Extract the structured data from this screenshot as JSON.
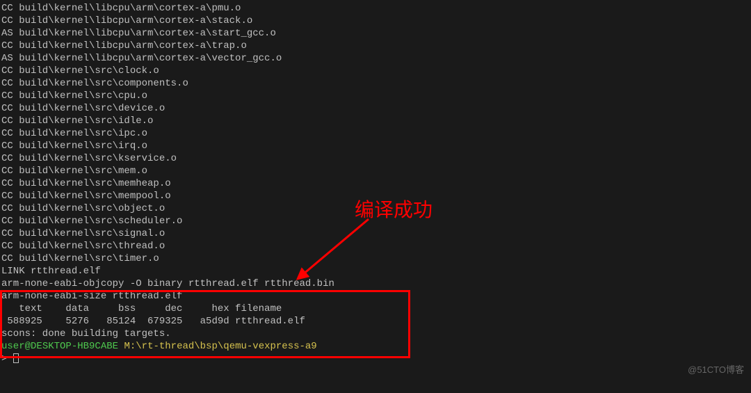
{
  "terminal": {
    "lines": [
      "CC build\\kernel\\libcpu\\arm\\cortex-a\\pmu.o",
      "CC build\\kernel\\libcpu\\arm\\cortex-a\\stack.o",
      "AS build\\kernel\\libcpu\\arm\\cortex-a\\start_gcc.o",
      "CC build\\kernel\\libcpu\\arm\\cortex-a\\trap.o",
      "AS build\\kernel\\libcpu\\arm\\cortex-a\\vector_gcc.o",
      "CC build\\kernel\\src\\clock.o",
      "CC build\\kernel\\src\\components.o",
      "CC build\\kernel\\src\\cpu.o",
      "CC build\\kernel\\src\\device.o",
      "CC build\\kernel\\src\\idle.o",
      "CC build\\kernel\\src\\ipc.o",
      "CC build\\kernel\\src\\irq.o",
      "CC build\\kernel\\src\\kservice.o",
      "CC build\\kernel\\src\\mem.o",
      "CC build\\kernel\\src\\memheap.o",
      "CC build\\kernel\\src\\mempool.o",
      "CC build\\kernel\\src\\object.o",
      "CC build\\kernel\\src\\scheduler.o",
      "CC build\\kernel\\src\\signal.o",
      "CC build\\kernel\\src\\thread.o",
      "CC build\\kernel\\src\\timer.o",
      "LINK rtthread.elf",
      "arm-none-eabi-objcopy -O binary rtthread.elf rtthread.bin",
      "arm-none-eabi-size rtthread.elf",
      "   text    data     bss     dec     hex filename",
      " 588925    5276   85124  679325   a5d9d rtthread.elf",
      "scons: done building targets."
    ],
    "prompt_user": "user",
    "prompt_at": "@",
    "prompt_host": "DESKTOP-HB9CABE",
    "prompt_sep": " ",
    "prompt_drive": "M:",
    "prompt_path": "\\rt-thread\\bsp\\qemu-vexpress-a9",
    "prompt_symbol": "> "
  },
  "annotation": {
    "text": "编译成功"
  },
  "watermark": "@51CTO博客"
}
